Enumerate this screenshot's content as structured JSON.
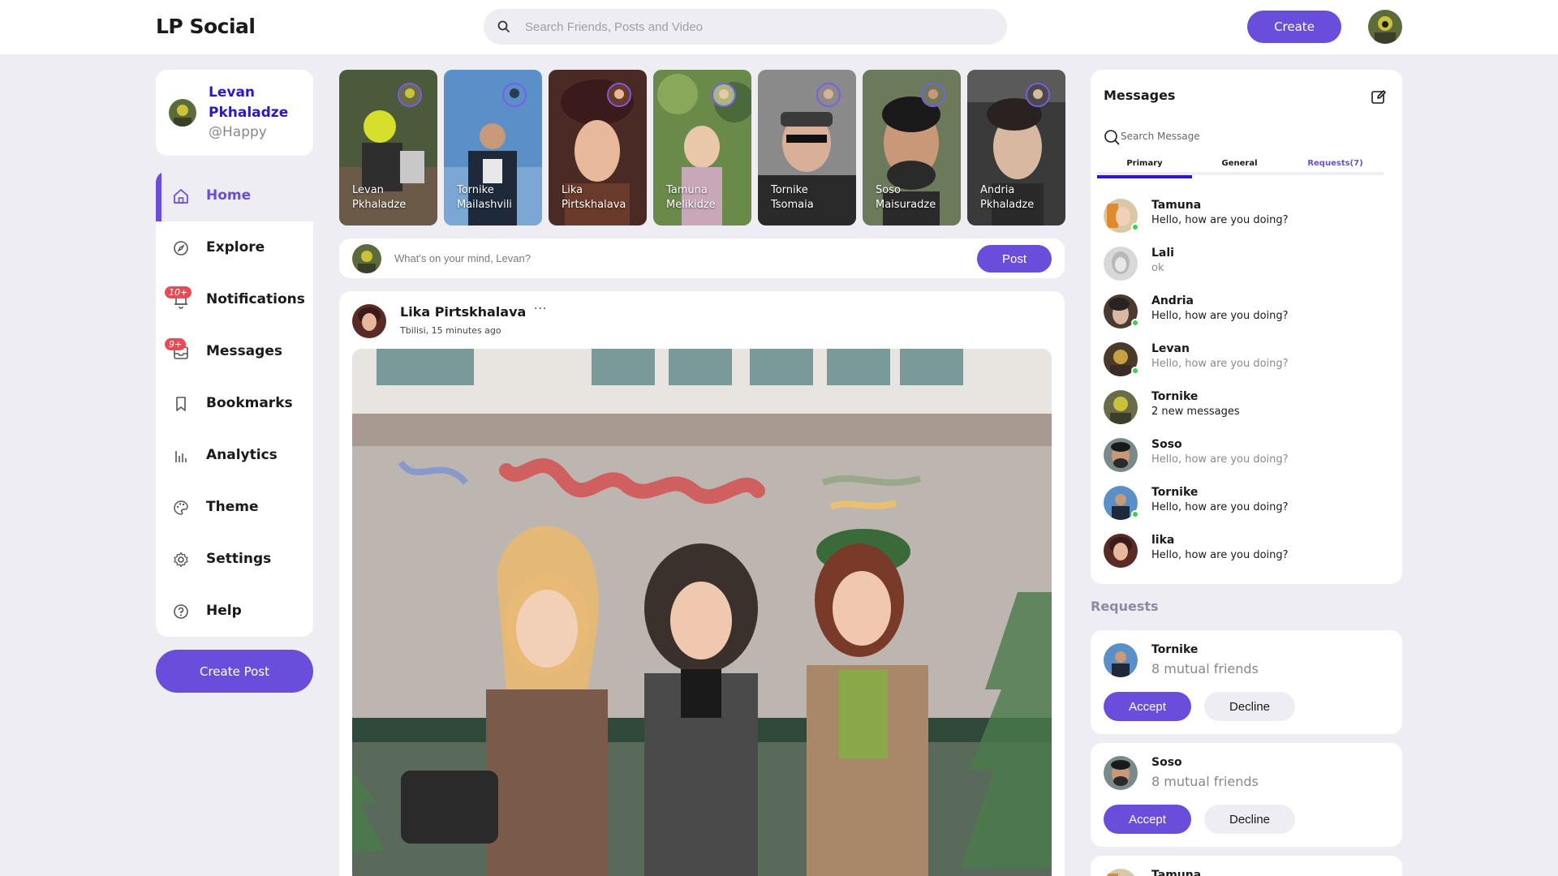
{
  "app": {
    "logo": "LP Social",
    "search_placeholder": "Search Friends, Posts and Video",
    "create_label": "Create",
    "accent": "#6a4ddb"
  },
  "profile": {
    "name": "Levan Pkhaladze",
    "handle": "@Happy"
  },
  "nav": {
    "items": [
      {
        "label": "Home",
        "icon": "home-icon",
        "active": true
      },
      {
        "label": "Explore",
        "icon": "compass-icon"
      },
      {
        "label": "Notifications",
        "icon": "bell-icon",
        "badge": "10+"
      },
      {
        "label": "Messages",
        "icon": "inbox-icon",
        "badge": "9+"
      },
      {
        "label": "Bookmarks",
        "icon": "bookmark-icon"
      },
      {
        "label": "Analytics",
        "icon": "bar-chart-icon"
      },
      {
        "label": "Theme",
        "icon": "palette-icon"
      },
      {
        "label": "Settings",
        "icon": "gear-icon"
      },
      {
        "label": "Help",
        "icon": "help-circle-icon"
      }
    ],
    "create_post_label": "Create Post"
  },
  "stories": [
    {
      "name": "Levan Pkhaladze"
    },
    {
      "name": "Tornike Mailashvili"
    },
    {
      "name": "Lika Pirtskhalava"
    },
    {
      "name": "Tamuna Melikidze"
    },
    {
      "name": "Tornike Tsomaia"
    },
    {
      "name": "Soso Maisuradze"
    },
    {
      "name": "Andria Pkhaladze"
    }
  ],
  "composer": {
    "placeholder": "What's on your mind, Levan?",
    "post_label": "Post"
  },
  "post": {
    "author": "Lika Pirtskhalava",
    "more": "···",
    "meta": "Tbilisi, 15 minutes ago"
  },
  "messages": {
    "title": "Messages",
    "search_placeholder": "Search Message",
    "tabs": [
      "Primary",
      "General",
      "Requests(7)"
    ],
    "items": [
      {
        "name": "Tamuna",
        "text": "Hello, how are you doing?",
        "online": true,
        "unread": true
      },
      {
        "name": "Lali",
        "text": "ok",
        "online": false,
        "unread": false
      },
      {
        "name": "Andria",
        "text": "Hello, how are you doing?",
        "online": true,
        "unread": true
      },
      {
        "name": "Levan",
        "text": "Hello, how are you doing?",
        "online": true,
        "unread": false
      },
      {
        "name": "Tornike",
        "text": "2 new messages",
        "online": false,
        "unread": true
      },
      {
        "name": "Soso",
        "text": "Hello, how are you doing?",
        "online": false,
        "unread": false
      },
      {
        "name": "Tornike",
        "text": "Hello, how are you doing?",
        "online": true,
        "unread": true
      },
      {
        "name": "lika",
        "text": "Hello, how are you doing?",
        "online": false,
        "unread": true
      }
    ]
  },
  "requests": {
    "title": "Requests",
    "accept_label": "Accept",
    "decline_label": "Decline",
    "items": [
      {
        "name": "Tornike",
        "mutual": "8 mutual friends"
      },
      {
        "name": "Soso",
        "mutual": "8 mutual friends"
      },
      {
        "name": "Tamuna",
        "mutual": ""
      }
    ]
  }
}
